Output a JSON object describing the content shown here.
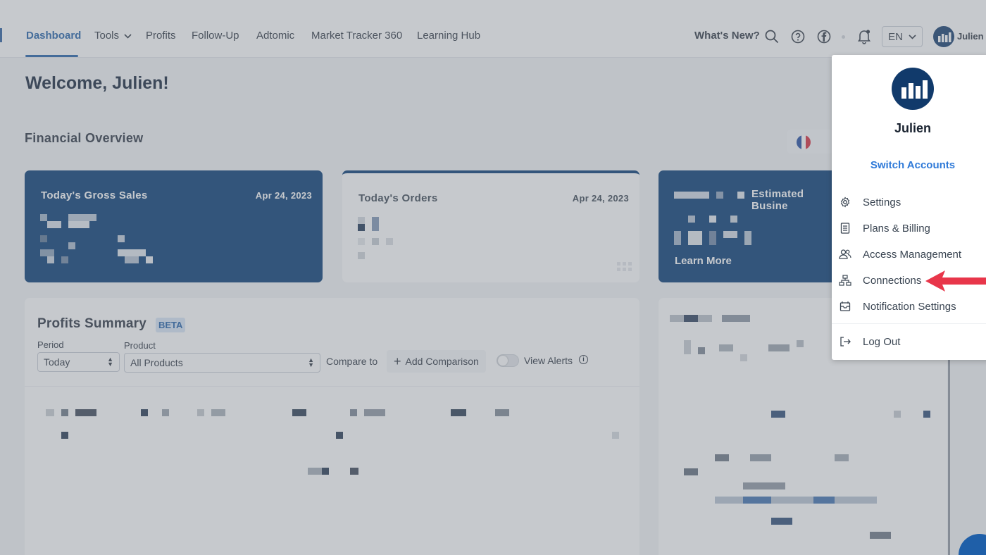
{
  "nav": {
    "items": [
      {
        "label": "Dashboard",
        "active": true
      },
      {
        "label": "Tools",
        "has_dropdown": true
      },
      {
        "label": "Profits"
      },
      {
        "label": "Follow-Up"
      },
      {
        "label": "Adtomic"
      },
      {
        "label": "Market Tracker 360"
      },
      {
        "label": "Learning Hub"
      }
    ],
    "whats_new": "What's New?",
    "icons": [
      "search-icon",
      "help-icon",
      "facebook-icon",
      "bell-icon"
    ],
    "language": "EN",
    "user_name": "Julien"
  },
  "main": {
    "welcome": "Welcome, Julien!",
    "financial_overview": "Financial Overview",
    "cards": [
      {
        "title": "Today's Gross Sales",
        "date": "Apr 24, 2023"
      },
      {
        "title": "Today's Orders",
        "date": "Apr 24, 2023"
      },
      {
        "title": "Estimated Busine",
        "cta": "Learn More"
      }
    ],
    "profits": {
      "title": "Profits Summary",
      "badge": "BETA",
      "period_label": "Period",
      "period_value": "Today",
      "product_label": "Product",
      "product_value": "All Products",
      "compare_label": "Compare to",
      "add_comparison": "Add Comparison",
      "view_alerts": "View Alerts",
      "info_glyph": "i",
      "add_glyph": "+"
    }
  },
  "user_menu": {
    "name": "Julien",
    "switch_accounts": "Switch Accounts",
    "items": [
      {
        "label": "Settings",
        "icon": "gear-icon"
      },
      {
        "label": "Plans & Billing",
        "icon": "document-icon"
      },
      {
        "label": "Access Management",
        "icon": "users-icon"
      },
      {
        "label": "Connections",
        "icon": "network-icon"
      },
      {
        "label": "Notification Settings",
        "icon": "envelope-icon"
      },
      {
        "label": "Log Out",
        "icon": "logout-icon"
      }
    ]
  },
  "colors": {
    "brand_navy": "#023872",
    "link_blue": "#2f7ad8",
    "arrow_red": "#e8364a"
  }
}
